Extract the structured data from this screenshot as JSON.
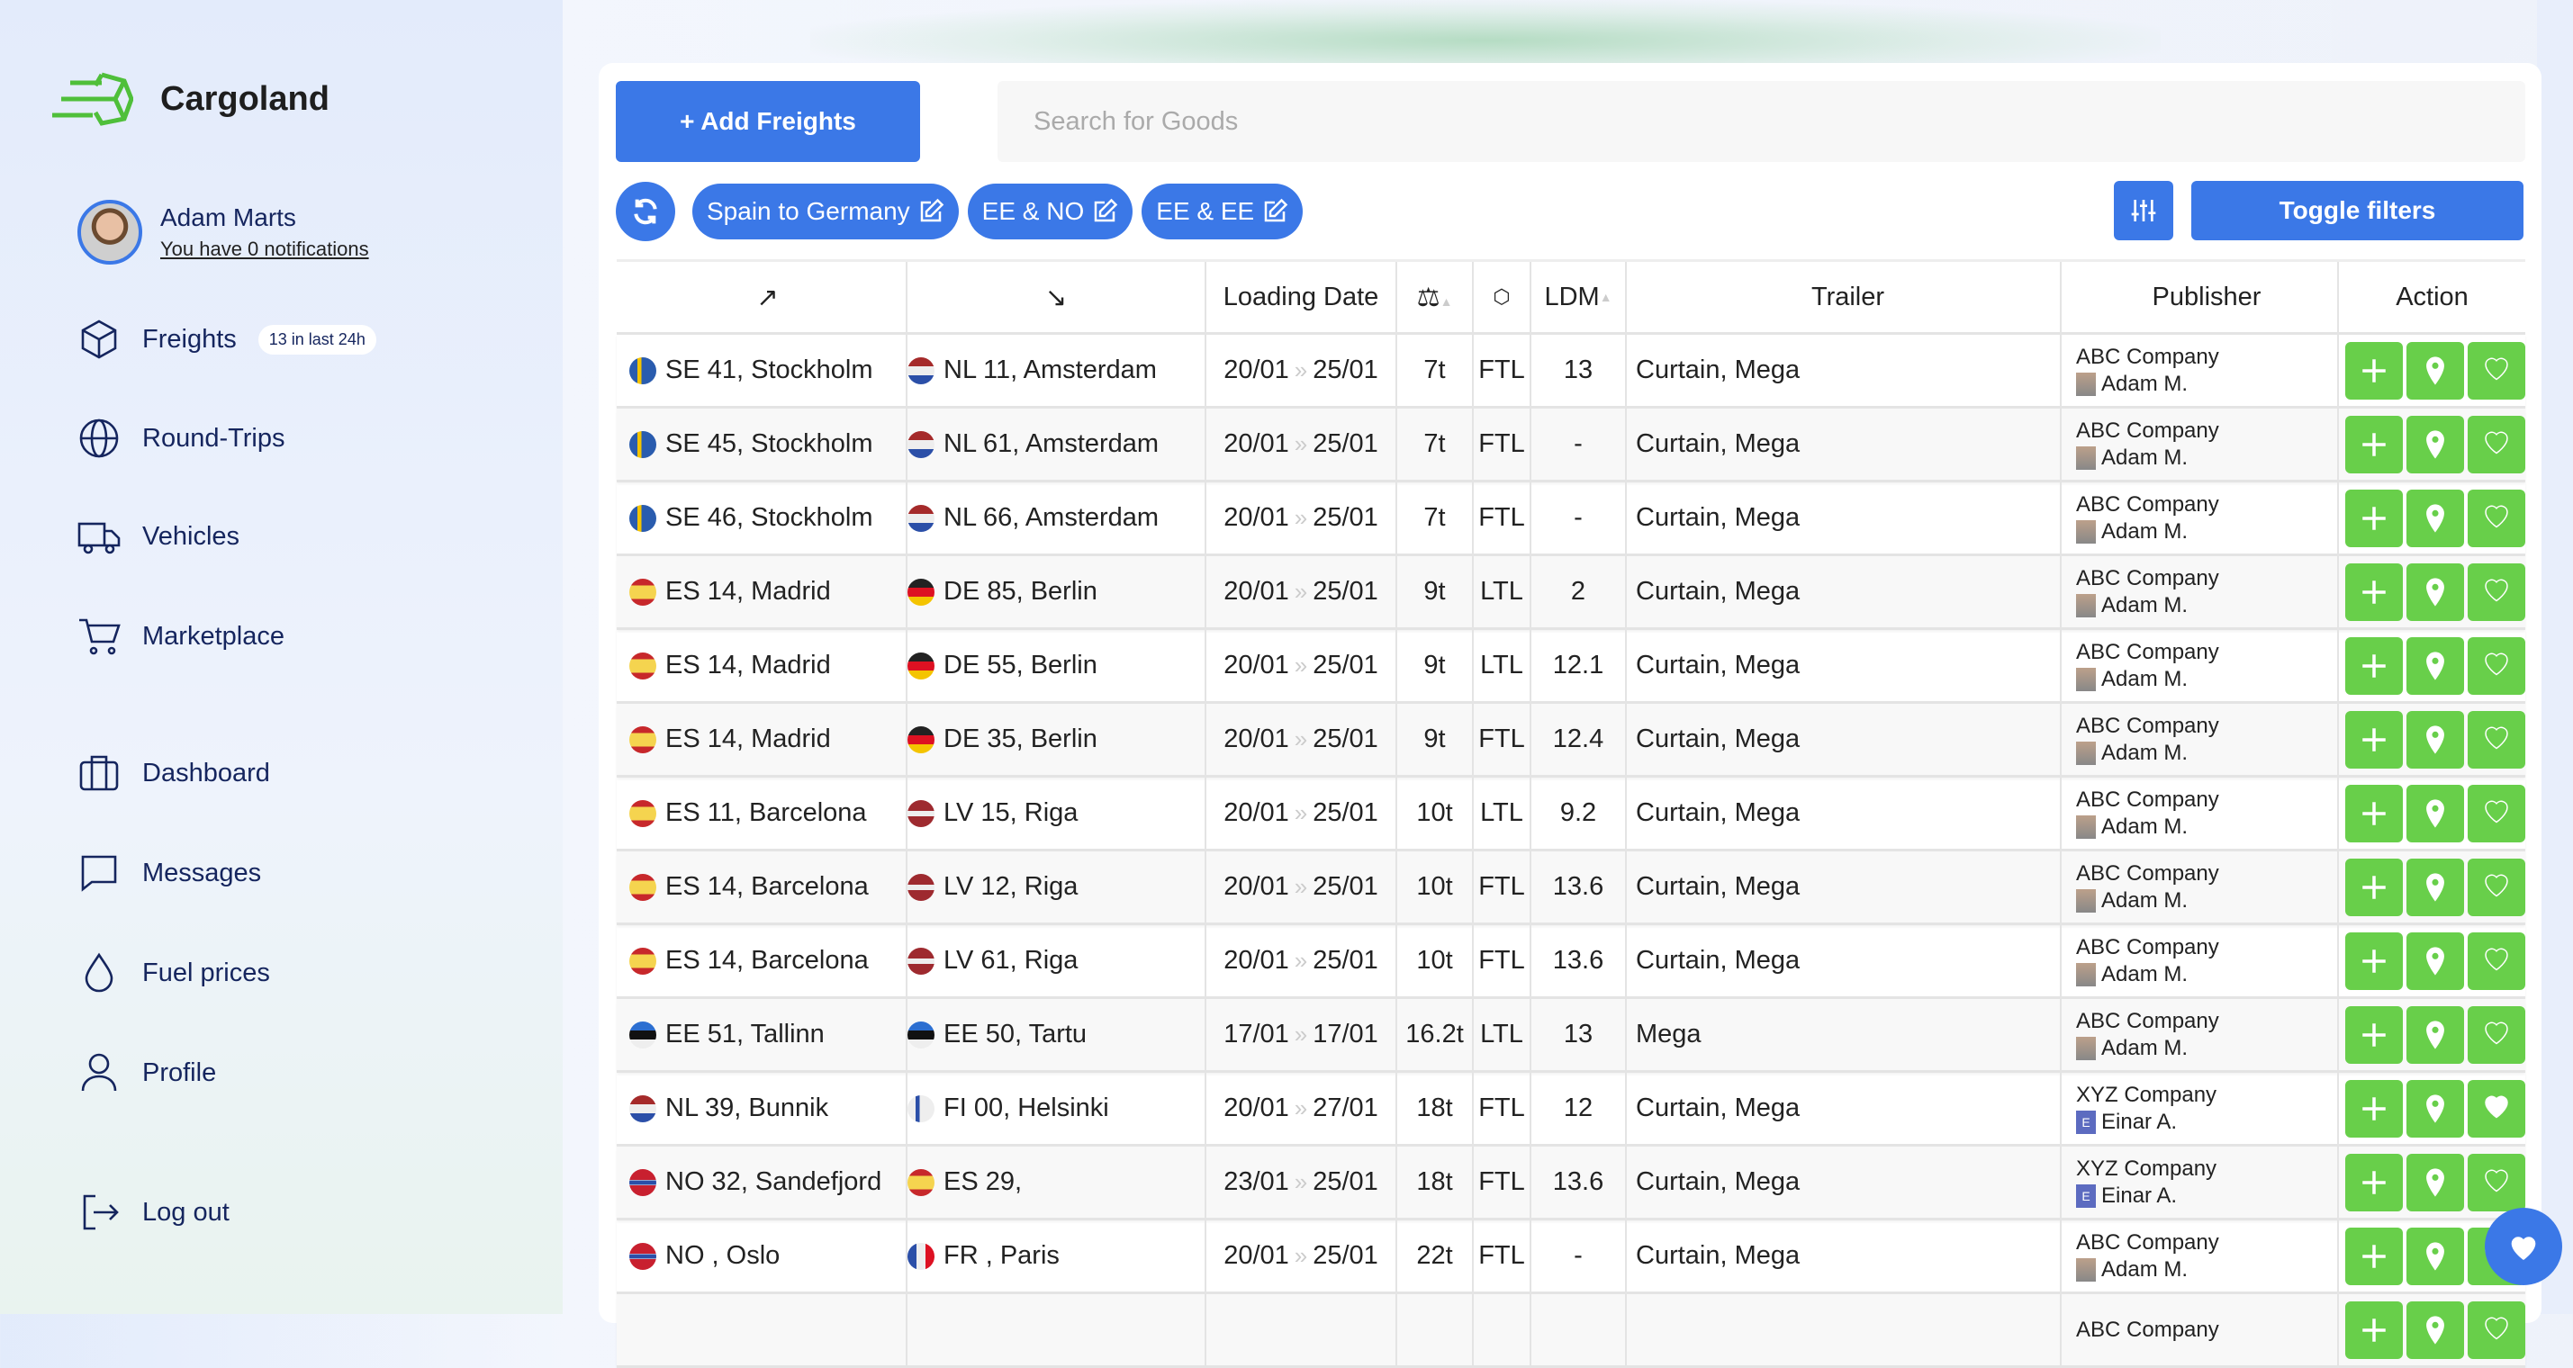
{
  "brand": {
    "name": "Cargoland",
    "accent": "#3b78e7",
    "green": "#68cf4a"
  },
  "user": {
    "name": "Adam Marts",
    "notifications": "You have 0 notifications"
  },
  "nav": [
    {
      "label": "Freights",
      "icon": "box-icon",
      "badge": "13 in last 24h"
    },
    {
      "label": "Round-Trips",
      "icon": "globe-icon"
    },
    {
      "label": "Vehicles",
      "icon": "truck-icon"
    },
    {
      "label": "Marketplace",
      "icon": "cart-icon"
    },
    {
      "label": "Dashboard",
      "icon": "briefcase-icon"
    },
    {
      "label": "Messages",
      "icon": "message-icon"
    },
    {
      "label": "Fuel prices",
      "icon": "drop-icon"
    },
    {
      "label": "Profile",
      "icon": "user-icon"
    },
    {
      "label": "Log out",
      "icon": "logout-icon"
    }
  ],
  "toolbar": {
    "add_label": "+ Add Freights",
    "search_placeholder": "Search for Goods",
    "toggle_label": "Toggle filters",
    "chips": [
      "Spain to Germany",
      "EE & NO",
      "EE & EE"
    ]
  },
  "table": {
    "headers": {
      "from": "↗",
      "to": "↘",
      "date": "Loading Date",
      "weight": "weight-scale-icon",
      "type": "box-icon",
      "ldm": "LDM",
      "trailer": "Trailer",
      "publisher": "Publisher",
      "action": "Action"
    },
    "rows": [
      {
        "from": "SE 41, Stockholm",
        "ff": "SE",
        "to": "NL 11, Amsterdam",
        "tf": "NL",
        "d1": "20/01",
        "d2": "25/01",
        "w": "7t",
        "t": "FTL",
        "ldm": "13",
        "trailer": "Curtain, Mega",
        "company": "ABC Company",
        "person": "Adam M.",
        "fav": false
      },
      {
        "from": "SE 45, Stockholm",
        "ff": "SE",
        "to": "NL 61, Amsterdam",
        "tf": "NL",
        "d1": "20/01",
        "d2": "25/01",
        "w": "7t",
        "t": "FTL",
        "ldm": "-",
        "trailer": "Curtain, Mega",
        "company": "ABC Company",
        "person": "Adam M.",
        "fav": false
      },
      {
        "from": "SE 46, Stockholm",
        "ff": "SE",
        "to": "NL 66, Amsterdam",
        "tf": "NL",
        "d1": "20/01",
        "d2": "25/01",
        "w": "7t",
        "t": "FTL",
        "ldm": "-",
        "trailer": "Curtain, Mega",
        "company": "ABC Company",
        "person": "Adam M.",
        "fav": false
      },
      {
        "from": "ES 14, Madrid",
        "ff": "ES",
        "to": "DE 85, Berlin",
        "tf": "DE",
        "d1": "20/01",
        "d2": "25/01",
        "w": "9t",
        "t": "LTL",
        "ldm": "2",
        "trailer": "Curtain, Mega",
        "company": "ABC Company",
        "person": "Adam M.",
        "fav": false
      },
      {
        "from": "ES 14, Madrid",
        "ff": "ES",
        "to": "DE 55, Berlin",
        "tf": "DE",
        "d1": "20/01",
        "d2": "25/01",
        "w": "9t",
        "t": "LTL",
        "ldm": "12.1",
        "trailer": "Curtain, Mega",
        "company": "ABC Company",
        "person": "Adam M.",
        "fav": false
      },
      {
        "from": "ES 14, Madrid",
        "ff": "ES",
        "to": "DE 35, Berlin",
        "tf": "DE",
        "d1": "20/01",
        "d2": "25/01",
        "w": "9t",
        "t": "FTL",
        "ldm": "12.4",
        "trailer": "Curtain, Mega",
        "company": "ABC Company",
        "person": "Adam M.",
        "fav": false
      },
      {
        "from": "ES 11, Barcelona",
        "ff": "ES",
        "to": "LV 15, Riga",
        "tf": "LV",
        "d1": "20/01",
        "d2": "25/01",
        "w": "10t",
        "t": "LTL",
        "ldm": "9.2",
        "trailer": "Curtain, Mega",
        "company": "ABC Company",
        "person": "Adam M.",
        "fav": false
      },
      {
        "from": "ES 14, Barcelona",
        "ff": "ES",
        "to": "LV 12, Riga",
        "tf": "LV",
        "d1": "20/01",
        "d2": "25/01",
        "w": "10t",
        "t": "FTL",
        "ldm": "13.6",
        "trailer": "Curtain, Mega",
        "company": "ABC Company",
        "person": "Adam M.",
        "fav": false
      },
      {
        "from": "ES 14, Barcelona",
        "ff": "ES",
        "to": "LV 61, Riga",
        "tf": "LV",
        "d1": "20/01",
        "d2": "25/01",
        "w": "10t",
        "t": "FTL",
        "ldm": "13.6",
        "trailer": "Curtain, Mega",
        "company": "ABC Company",
        "person": "Adam M.",
        "fav": false
      },
      {
        "from": "EE 51, Tallinn",
        "ff": "EE",
        "to": "EE 50, Tartu",
        "tf": "EE",
        "d1": "17/01",
        "d2": "17/01",
        "w": "16.2t",
        "t": "LTL",
        "ldm": "13",
        "trailer": "Mega",
        "company": "ABC Company",
        "person": "Adam M.",
        "fav": false
      },
      {
        "from": "NL 39, Bunnik",
        "ff": "NL",
        "to": "FI 00, Helsinki",
        "tf": "FI",
        "d1": "20/01",
        "d2": "27/01",
        "w": "18t",
        "t": "FTL",
        "ldm": "12",
        "trailer": "Curtain, Mega",
        "company": "XYZ Company",
        "person": "Einar A.",
        "fav": true
      },
      {
        "from": "NO 32, Sandefjord",
        "ff": "NO",
        "to": "ES 29,",
        "tf": "ES",
        "d1": "23/01",
        "d2": "25/01",
        "w": "18t",
        "t": "FTL",
        "ldm": "13.6",
        "trailer": "Curtain, Mega",
        "company": "XYZ Company",
        "person": "Einar A.",
        "fav": false
      },
      {
        "from": "NO , Oslo",
        "ff": "NO",
        "to": "FR , Paris",
        "tf": "FR",
        "d1": "20/01",
        "d2": "25/01",
        "w": "22t",
        "t": "FTL",
        "ldm": "-",
        "trailer": "Curtain, Mega",
        "company": "ABC Company",
        "person": "Adam M.",
        "fav": false
      },
      {
        "from": "",
        "ff": "",
        "to": "",
        "tf": "",
        "d1": "",
        "d2": "",
        "w": "",
        "t": "",
        "ldm": "",
        "trailer": "",
        "company": "ABC Company",
        "person": "",
        "fav": false
      }
    ]
  }
}
